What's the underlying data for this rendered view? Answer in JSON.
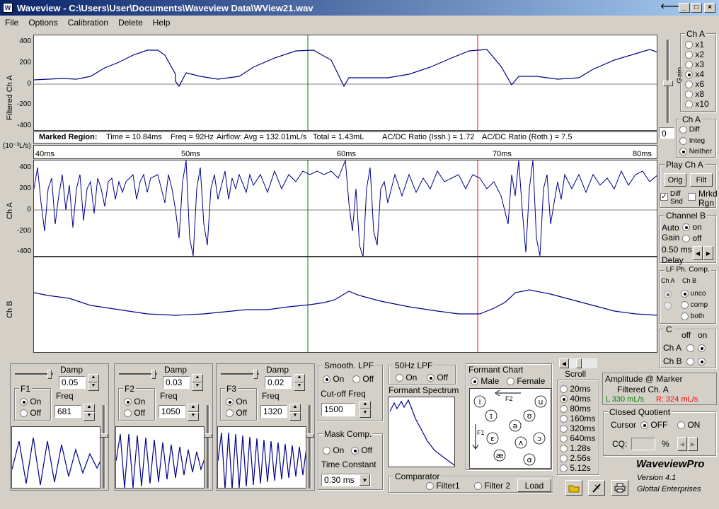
{
  "window": {
    "title": "Waveview - C:\\Users\\User\\Documents\\Waveview Data\\WView21.wav",
    "title_icon": "waveview-icon"
  },
  "menu": [
    "File",
    "Options",
    "Calibration",
    "Delete",
    "Help"
  ],
  "plots": {
    "filtered_label": "Filtered Ch A",
    "filtered_ticks": [
      "400",
      "200",
      "0",
      "-200",
      "-400"
    ],
    "marked_region": {
      "label": "Marked Region:",
      "time": "Time = 10.84ms",
      "freq": "Freq = 92Hz",
      "airflow": "Airflow: Avg = 132.01mL/s",
      "total": "Total = 1.43mL",
      "acdc_issh": "AC/DC Ratio (Issh.) = 1.72",
      "acdc_roth": "AC/DC Ratio (Roth.) = 7.5"
    },
    "unit_label": "(10⁻³L/s)",
    "time_ticks": [
      "40ms",
      "50ms",
      "60ms",
      "70ms",
      "80ms"
    ],
    "cha_label": "Ch A",
    "cha_ticks": [
      "400",
      "200",
      "0",
      "-200",
      "-400"
    ],
    "chb_label": "Ch B",
    "cursor_green_color": "#008000",
    "cursor_red_color": "#ff0000",
    "wave_color": "#00008b"
  },
  "gain": {
    "title": "Ch A",
    "label": "Gain",
    "options": [
      "x1",
      "x2",
      "x3",
      "x4",
      "x6",
      "x8",
      "x10"
    ],
    "selected": "x4",
    "value": "0"
  },
  "cha_mode": {
    "title": "Ch A",
    "options": [
      "Diff",
      "Integ",
      "Neither"
    ],
    "selected": "Neither"
  },
  "play": {
    "title": "Play Ch A",
    "orig": "Orig",
    "filt": "Filt",
    "diff_snd": "Diff Snd",
    "diff_snd_checked": true,
    "mrkd_rgn": "Mrkd Rgn",
    "mrkd_rgn_checked": false
  },
  "channel_b": {
    "title": "Channel B",
    "auto_gain": "Auto Gain",
    "on": "on",
    "off": "off",
    "selected": "on",
    "delay_value": "0.50 ms",
    "delay_label": "Delay"
  },
  "lf_comp": {
    "title": "LF Ph. Comp.",
    "cha": "Ch A",
    "chb": "Ch B",
    "options": [
      "unco",
      "comp",
      "both"
    ],
    "selected": "unco"
  },
  "c_box": {
    "title": "C",
    "off": "off",
    "on": "on",
    "cha": "Ch A",
    "chb": "Ch B",
    "cha_selected": "on",
    "chb_selected": "on"
  },
  "filters": [
    {
      "name": "F1",
      "damp_label": "Damp",
      "damp": "0.05",
      "on": "On",
      "off": "Off",
      "selected": "On",
      "freq_label": "Freq",
      "freq": "681"
    },
    {
      "name": "F2",
      "damp_label": "Damp",
      "damp": "0.03",
      "on": "On",
      "off": "Off",
      "selected": "On",
      "freq_label": "Freq",
      "freq": "1050"
    },
    {
      "name": "F3",
      "damp_label": "Damp",
      "damp": "0.02",
      "on": "On",
      "off": "Off",
      "selected": "On",
      "freq_label": "Freq",
      "freq": "1320"
    }
  ],
  "smooth": {
    "title": "Smooth. LPF",
    "on": "On",
    "off": "Off",
    "selected": "On",
    "cutoff_label": "Cut-off Freq",
    "cutoff": "1500"
  },
  "mask": {
    "title": "Mask Comp.",
    "on": "On",
    "off": "Off",
    "selected": "Off",
    "tc_label": "Time Constant",
    "tc": "0.30 ms"
  },
  "lpf50": {
    "title": "50Hz LPF",
    "on": "On",
    "off": "Off",
    "selected": "Off"
  },
  "formant_spectrum": {
    "title": "Formant Spectrum"
  },
  "comparator": {
    "title": "Comparator",
    "filter1": "Filter1",
    "filter2": "Filter 2",
    "load": "Load"
  },
  "formant_chart": {
    "title": "Formant Chart",
    "male": "Male",
    "female": "Female",
    "selected": "Male",
    "f1": "F1",
    "f2": "F2",
    "vowels": [
      "i",
      "u",
      "ɪ",
      "ʊ",
      "ə",
      "ɛ",
      "ɔ",
      "ʌ",
      "æ",
      "ɑ"
    ]
  },
  "scroll": {
    "title": "Scroll",
    "options": [
      "20ms",
      "40ms",
      "80ms",
      "160ms",
      "320ms",
      "640ms",
      "1.28s",
      "2.56s",
      "5.12s"
    ],
    "selected": "40ms"
  },
  "amplitude": {
    "title": "Amplitude @ Marker",
    "channel": "Filtered Ch. A",
    "left": "L 330 mL/s",
    "right": "R: 324 mL/s",
    "left_color": "#008000",
    "right_color": "#ff0000"
  },
  "closed_quotient": {
    "title": "Closed Quotient",
    "cursor_label": "Cursor",
    "off": "OFF",
    "on": "ON",
    "selected": "OFF",
    "cq_label": "CQ:",
    "cq_value": "",
    "percent": "%"
  },
  "brand": {
    "name": "WaveviewPro",
    "version": "Version 4.1",
    "company": "Glottal Enterprises"
  }
}
